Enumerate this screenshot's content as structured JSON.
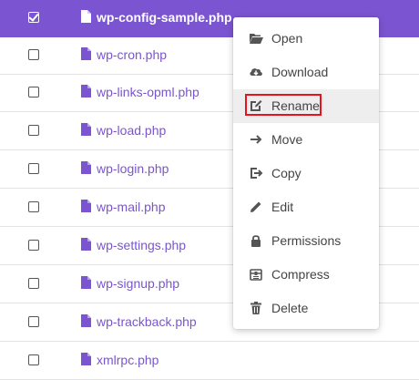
{
  "files": [
    {
      "name": "wp-config-sample.php",
      "selected": true
    },
    {
      "name": "wp-cron.php",
      "selected": false
    },
    {
      "name": "wp-links-opml.php",
      "selected": false
    },
    {
      "name": "wp-load.php",
      "selected": false
    },
    {
      "name": "wp-login.php",
      "selected": false
    },
    {
      "name": "wp-mail.php",
      "selected": false
    },
    {
      "name": "wp-settings.php",
      "selected": false
    },
    {
      "name": "wp-signup.php",
      "selected": false
    },
    {
      "name": "wp-trackback.php",
      "selected": false
    },
    {
      "name": "xmlrpc.php",
      "selected": false
    }
  ],
  "context_menu": {
    "items": [
      {
        "label": "Open",
        "icon": "folder-open-icon"
      },
      {
        "label": "Download",
        "icon": "cloud-download-icon"
      },
      {
        "label": "Rename",
        "icon": "rename-icon",
        "hovered": true
      },
      {
        "label": "Move",
        "icon": "arrow-right-icon"
      },
      {
        "label": "Copy",
        "icon": "copy-icon"
      },
      {
        "label": "Edit",
        "icon": "pencil-icon"
      },
      {
        "label": "Permissions",
        "icon": "lock-icon"
      },
      {
        "label": "Compress",
        "icon": "archive-icon"
      },
      {
        "label": "Delete",
        "icon": "trash-icon"
      }
    ]
  },
  "colors": {
    "accent": "#7b54d1",
    "highlight": "#e8141c",
    "menu_hover": "#eeeeee"
  }
}
